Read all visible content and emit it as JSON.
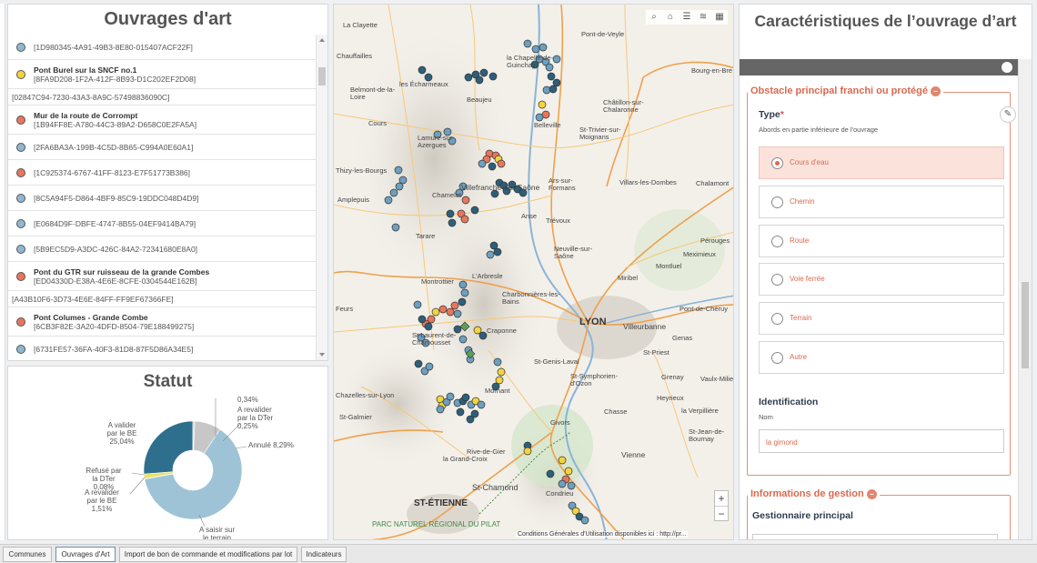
{
  "list": {
    "title": "Ouvrages d'art",
    "items": [
      {
        "name": "",
        "code": "[1D980345-4A91-49B3-8E80-015407ACF22F]",
        "color": "#8fb7cf"
      },
      {
        "name": "Pont Burel sur la SNCF no.1",
        "code": "[8FA9D208-1F2A-412F-8B93-D1C202EF2D08]",
        "color": "#f2d43f"
      },
      {
        "name": "",
        "code": "[02847C94-7230-43A3-8A9C-57498836090C]",
        "color": "",
        "plain": true
      },
      {
        "name": "Mur de la route de Corrompt",
        "code": "[1B94FF8E-A780-44C3-89A2-D658C0E2FA5A]",
        "color": "#e8765c"
      },
      {
        "name": "",
        "code": "[2FA6BA3A-199B-4C5D-8B65-C994A0E60A1]",
        "color": "#8fb7cf"
      },
      {
        "name": "",
        "code": "[1C925374-6767-41FF-8123-E7F51773B386]",
        "color": "#e8765c"
      },
      {
        "name": "",
        "code": "[8C5A94F5-D864-4BF9-85C9-19DDC048D4D9]",
        "color": "#8fb7cf"
      },
      {
        "name": "",
        "code": "[E0684D9F-DBFE-4747-8B55-04EF9414BA79]",
        "color": "#8fb7cf"
      },
      {
        "name": "",
        "code": "[5B9EC5D9-A3DC-426C-84A2-72341680E8A0]",
        "color": "#8fb7cf"
      },
      {
        "name": "Pont du GTR sur ruisseau de la grande Combes",
        "code": "[ED04330D-E38A-4E6E-8CFE-0304544E162B]",
        "color": "#e8765c"
      },
      {
        "name": "",
        "code": "[A43B10F6-3D73-4E6E-84FF-FF9EF67366FE]",
        "color": "",
        "plain": true
      },
      {
        "name": "Pont Columes - Grande Combe",
        "code": "[6CB3F82E-3A20-4DFD-8504-79E188499275]",
        "color": "#e8765c"
      },
      {
        "name": "",
        "code": "[6731FE57-36FA-40F3-81D8-87F5D86A34E5]",
        "color": "#8fb7cf"
      }
    ]
  },
  "status": {
    "title": "Statut",
    "chart_data": {
      "type": "pie",
      "title": "Statut",
      "series": [
        {
          "name": "A saisir sur le terrain",
          "value": 60.0,
          "color": "#9fc3d6",
          "label": "A saisir sur le terrain"
        },
        {
          "name": "Refusé par la DTer",
          "value": 0.08,
          "color": "#2e6f8e",
          "label": "Refusé par la DTer 0,08%"
        },
        {
          "name": "A revalider par le BE",
          "value": 1.51,
          "color": "#e9e36a",
          "label": "A revalider par le BE 1,51%"
        },
        {
          "name": "A valider par le BE",
          "value": 25.04,
          "color": "#2e6f8e",
          "label": "A valider par le BE 25,04%"
        },
        {
          "name": "",
          "value": 0.34,
          "color": "#e8765c",
          "label": "0,34%"
        },
        {
          "name": "A revalider par la DTer",
          "value": 0.25,
          "color": "#e8765c",
          "label": "A revalider par la DTer 0,25%"
        },
        {
          "name": "Annulé",
          "value": 8.29,
          "color": "#c7c7c7",
          "label": "Annulé 8,29%"
        }
      ]
    },
    "labels": {
      "a_valider": "A valider\npar le BE\n25,04%",
      "pct_034": "0,34%",
      "a_revalider_dter": "A revalider\npar la DTer\n0,25%",
      "annule": "Annulé 8,29%",
      "refuse": "Refusé par\nla DTer\n0,08%",
      "a_revalider_be": "A revalider\npar le BE\n1,51%",
      "a_saisir": "A saisir sur\nle terrain"
    }
  },
  "map": {
    "places": {
      "la_clayette": "La Clayette",
      "chauffailles": "Chauffailles",
      "belmont": "Belmont-de-la-\nLoire",
      "les_echarmeaux": "les Écharmeaux",
      "beaujeu": "Beaujeu",
      "cours": "Cours",
      "lamure": "Lamure-sur-\nAzergues",
      "thizy": "Thizy-les-Bourgs",
      "amplepuis": "Amplepuis",
      "chamelet": "Chamelet",
      "villefranche": "Villefranche-sur-Saône",
      "anse": "Anse",
      "tarare": "Tarare",
      "larbresle": "L'Arbresle",
      "charbonnieres": "Charbonnières-les-\nBains",
      "craponne": "Craponne",
      "lyon": "LYON",
      "villeurbanne": "Villeurbanne",
      "st_genis": "St-Genis-Laval",
      "st_symphorien": "St-Symphorien-\nd'Ozon",
      "chazelles": "Chazelles-sur-Lyon",
      "st_galmier": "St-Galmier",
      "givors": "Givors",
      "rive_de_gier": "Rive-de-Gier",
      "la_grand_croix": "la Grand-Croix",
      "st_chamond": "St-Chamond",
      "st_etienne": "ST-ÉTIENNE",
      "condrieu": "Condrieu",
      "vienne": "Vienne",
      "pilat": "PARC NATUREL RÉGIONAL DU PILAT",
      "bourg": "Bourg-en-Bre",
      "chatillon": "Châtillon-sur-\nChalaronne",
      "st_trivier": "St-Trivier-sur-\nMoignans",
      "villars": "Villars-les-Dombes",
      "chalamont": "Chalamont",
      "perouges": "Pérouges",
      "meximieux": "Meximieux",
      "montluel": "Montluel",
      "miribel": "Miribel",
      "neuville": "Neuville-sur-\nSaône",
      "trevoux": "Trévoux",
      "st_jean_bournay": "St-Jean-de-\nBournay",
      "heyrieux": "Heyrieux",
      "la_verpilliere": "la Verpillière",
      "st_priest": "St-Priest",
      "pont_cheruy": "Pont-de-Chéruy",
      "feurs": "Feurs",
      "montrottier": "Montrottier",
      "st_laurent": "St-Laurent-de-\nChamousset",
      "mornant": "Mornant",
      "genas": "Genas",
      "villefranche2": "Ars-sur-\nFormans",
      "la_chapelle": "la Chapelle-de-\nGuinchay",
      "pont_veyle": "Pont-de-Veyle",
      "belleville": "Belleville",
      "vaulx": "Vaulx-Milieu",
      "chasse": "Chasse",
      "beaurepaire": "Grenay"
    },
    "attribution": "Conditions Générales d'Utilisation disponibles ici : http://pr...",
    "zoom_in": "+",
    "zoom_out": "−"
  },
  "detail": {
    "title": "Caractéristiques de l’ouvrage d’art",
    "section1": "Obstacle principal franchi ou protégé",
    "type_label": "Type",
    "type_required": "*",
    "type_help": "Abords en partie inférieure de l'ouvrage",
    "options": [
      "Cours d'eau",
      "Chemin",
      "Route",
      "Voie ferrée",
      "Terrain",
      "Autre"
    ],
    "selected_option": "Cours d'eau",
    "ident_label": "Identification",
    "nom_help": "Nom",
    "nom_value": "la gimond",
    "section2": "Informations de gestion",
    "gestionnaire_label": "Gestionnaire principal"
  },
  "tabs": [
    "Communes",
    "Ouvrages d'Art",
    "Import de bon de commande et modifications par lot",
    "Indicateurs"
  ],
  "active_tab": "Ouvrages d'Art"
}
